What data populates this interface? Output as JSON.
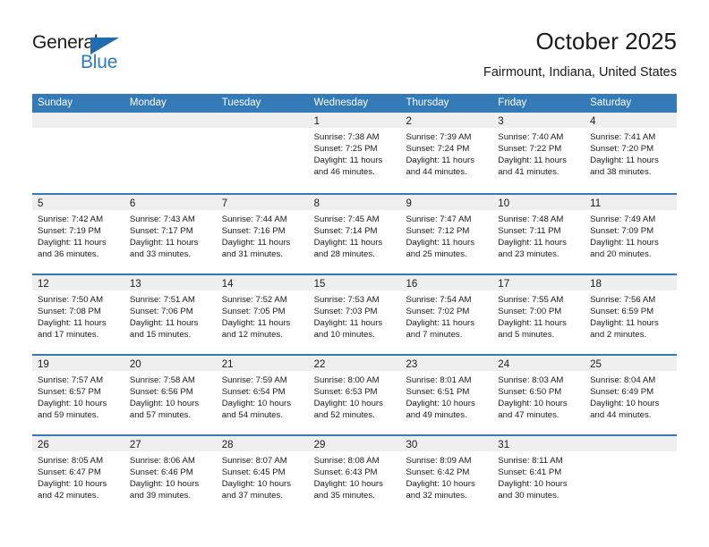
{
  "brand": {
    "name_top": "General",
    "name_bottom": "Blue",
    "triangle_color": "#1f6cb0",
    "blue_text_color": "#2b7cc4"
  },
  "header": {
    "title": "October 2025",
    "subtitle": "Fairmount, Indiana, United States"
  },
  "theme": {
    "header_row_bg": "#337ab7",
    "header_row_text": "#ffffff",
    "daynum_band_bg": "#efefef",
    "separator": "#337ab7"
  },
  "weekday_headers": [
    "Sunday",
    "Monday",
    "Tuesday",
    "Wednesday",
    "Thursday",
    "Friday",
    "Saturday"
  ],
  "weeks": [
    [
      {
        "day": "",
        "empty": true,
        "sunrise": "",
        "sunset": "",
        "daylight1": "",
        "daylight2": ""
      },
      {
        "day": "",
        "empty": true,
        "sunrise": "",
        "sunset": "",
        "daylight1": "",
        "daylight2": ""
      },
      {
        "day": "",
        "empty": true,
        "sunrise": "",
        "sunset": "",
        "daylight1": "",
        "daylight2": ""
      },
      {
        "day": "1",
        "empty": false,
        "sunrise": "Sunrise: 7:38 AM",
        "sunset": "Sunset: 7:25 PM",
        "daylight1": "Daylight: 11 hours",
        "daylight2": "and 46 minutes."
      },
      {
        "day": "2",
        "empty": false,
        "sunrise": "Sunrise: 7:39 AM",
        "sunset": "Sunset: 7:24 PM",
        "daylight1": "Daylight: 11 hours",
        "daylight2": "and 44 minutes."
      },
      {
        "day": "3",
        "empty": false,
        "sunrise": "Sunrise: 7:40 AM",
        "sunset": "Sunset: 7:22 PM",
        "daylight1": "Daylight: 11 hours",
        "daylight2": "and 41 minutes."
      },
      {
        "day": "4",
        "empty": false,
        "sunrise": "Sunrise: 7:41 AM",
        "sunset": "Sunset: 7:20 PM",
        "daylight1": "Daylight: 11 hours",
        "daylight2": "and 38 minutes."
      }
    ],
    [
      {
        "day": "5",
        "empty": false,
        "sunrise": "Sunrise: 7:42 AM",
        "sunset": "Sunset: 7:19 PM",
        "daylight1": "Daylight: 11 hours",
        "daylight2": "and 36 minutes."
      },
      {
        "day": "6",
        "empty": false,
        "sunrise": "Sunrise: 7:43 AM",
        "sunset": "Sunset: 7:17 PM",
        "daylight1": "Daylight: 11 hours",
        "daylight2": "and 33 minutes."
      },
      {
        "day": "7",
        "empty": false,
        "sunrise": "Sunrise: 7:44 AM",
        "sunset": "Sunset: 7:16 PM",
        "daylight1": "Daylight: 11 hours",
        "daylight2": "and 31 minutes."
      },
      {
        "day": "8",
        "empty": false,
        "sunrise": "Sunrise: 7:45 AM",
        "sunset": "Sunset: 7:14 PM",
        "daylight1": "Daylight: 11 hours",
        "daylight2": "and 28 minutes."
      },
      {
        "day": "9",
        "empty": false,
        "sunrise": "Sunrise: 7:47 AM",
        "sunset": "Sunset: 7:12 PM",
        "daylight1": "Daylight: 11 hours",
        "daylight2": "and 25 minutes."
      },
      {
        "day": "10",
        "empty": false,
        "sunrise": "Sunrise: 7:48 AM",
        "sunset": "Sunset: 7:11 PM",
        "daylight1": "Daylight: 11 hours",
        "daylight2": "and 23 minutes."
      },
      {
        "day": "11",
        "empty": false,
        "sunrise": "Sunrise: 7:49 AM",
        "sunset": "Sunset: 7:09 PM",
        "daylight1": "Daylight: 11 hours",
        "daylight2": "and 20 minutes."
      }
    ],
    [
      {
        "day": "12",
        "empty": false,
        "sunrise": "Sunrise: 7:50 AM",
        "sunset": "Sunset: 7:08 PM",
        "daylight1": "Daylight: 11 hours",
        "daylight2": "and 17 minutes."
      },
      {
        "day": "13",
        "empty": false,
        "sunrise": "Sunrise: 7:51 AM",
        "sunset": "Sunset: 7:06 PM",
        "daylight1": "Daylight: 11 hours",
        "daylight2": "and 15 minutes."
      },
      {
        "day": "14",
        "empty": false,
        "sunrise": "Sunrise: 7:52 AM",
        "sunset": "Sunset: 7:05 PM",
        "daylight1": "Daylight: 11 hours",
        "daylight2": "and 12 minutes."
      },
      {
        "day": "15",
        "empty": false,
        "sunrise": "Sunrise: 7:53 AM",
        "sunset": "Sunset: 7:03 PM",
        "daylight1": "Daylight: 11 hours",
        "daylight2": "and 10 minutes."
      },
      {
        "day": "16",
        "empty": false,
        "sunrise": "Sunrise: 7:54 AM",
        "sunset": "Sunset: 7:02 PM",
        "daylight1": "Daylight: 11 hours",
        "daylight2": "and 7 minutes."
      },
      {
        "day": "17",
        "empty": false,
        "sunrise": "Sunrise: 7:55 AM",
        "sunset": "Sunset: 7:00 PM",
        "daylight1": "Daylight: 11 hours",
        "daylight2": "and 5 minutes."
      },
      {
        "day": "18",
        "empty": false,
        "sunrise": "Sunrise: 7:56 AM",
        "sunset": "Sunset: 6:59 PM",
        "daylight1": "Daylight: 11 hours",
        "daylight2": "and 2 minutes."
      }
    ],
    [
      {
        "day": "19",
        "empty": false,
        "sunrise": "Sunrise: 7:57 AM",
        "sunset": "Sunset: 6:57 PM",
        "daylight1": "Daylight: 10 hours",
        "daylight2": "and 59 minutes."
      },
      {
        "day": "20",
        "empty": false,
        "sunrise": "Sunrise: 7:58 AM",
        "sunset": "Sunset: 6:56 PM",
        "daylight1": "Daylight: 10 hours",
        "daylight2": "and 57 minutes."
      },
      {
        "day": "21",
        "empty": false,
        "sunrise": "Sunrise: 7:59 AM",
        "sunset": "Sunset: 6:54 PM",
        "daylight1": "Daylight: 10 hours",
        "daylight2": "and 54 minutes."
      },
      {
        "day": "22",
        "empty": false,
        "sunrise": "Sunrise: 8:00 AM",
        "sunset": "Sunset: 6:53 PM",
        "daylight1": "Daylight: 10 hours",
        "daylight2": "and 52 minutes."
      },
      {
        "day": "23",
        "empty": false,
        "sunrise": "Sunrise: 8:01 AM",
        "sunset": "Sunset: 6:51 PM",
        "daylight1": "Daylight: 10 hours",
        "daylight2": "and 49 minutes."
      },
      {
        "day": "24",
        "empty": false,
        "sunrise": "Sunrise: 8:03 AM",
        "sunset": "Sunset: 6:50 PM",
        "daylight1": "Daylight: 10 hours",
        "daylight2": "and 47 minutes."
      },
      {
        "day": "25",
        "empty": false,
        "sunrise": "Sunrise: 8:04 AM",
        "sunset": "Sunset: 6:49 PM",
        "daylight1": "Daylight: 10 hours",
        "daylight2": "and 44 minutes."
      }
    ],
    [
      {
        "day": "26",
        "empty": false,
        "sunrise": "Sunrise: 8:05 AM",
        "sunset": "Sunset: 6:47 PM",
        "daylight1": "Daylight: 10 hours",
        "daylight2": "and 42 minutes."
      },
      {
        "day": "27",
        "empty": false,
        "sunrise": "Sunrise: 8:06 AM",
        "sunset": "Sunset: 6:46 PM",
        "daylight1": "Daylight: 10 hours",
        "daylight2": "and 39 minutes."
      },
      {
        "day": "28",
        "empty": false,
        "sunrise": "Sunrise: 8:07 AM",
        "sunset": "Sunset: 6:45 PM",
        "daylight1": "Daylight: 10 hours",
        "daylight2": "and 37 minutes."
      },
      {
        "day": "29",
        "empty": false,
        "sunrise": "Sunrise: 8:08 AM",
        "sunset": "Sunset: 6:43 PM",
        "daylight1": "Daylight: 10 hours",
        "daylight2": "and 35 minutes."
      },
      {
        "day": "30",
        "empty": false,
        "sunrise": "Sunrise: 8:09 AM",
        "sunset": "Sunset: 6:42 PM",
        "daylight1": "Daylight: 10 hours",
        "daylight2": "and 32 minutes."
      },
      {
        "day": "31",
        "empty": false,
        "sunrise": "Sunrise: 8:11 AM",
        "sunset": "Sunset: 6:41 PM",
        "daylight1": "Daylight: 10 hours",
        "daylight2": "and 30 minutes."
      },
      {
        "day": "",
        "empty": true,
        "sunrise": "",
        "sunset": "",
        "daylight1": "",
        "daylight2": ""
      }
    ]
  ]
}
